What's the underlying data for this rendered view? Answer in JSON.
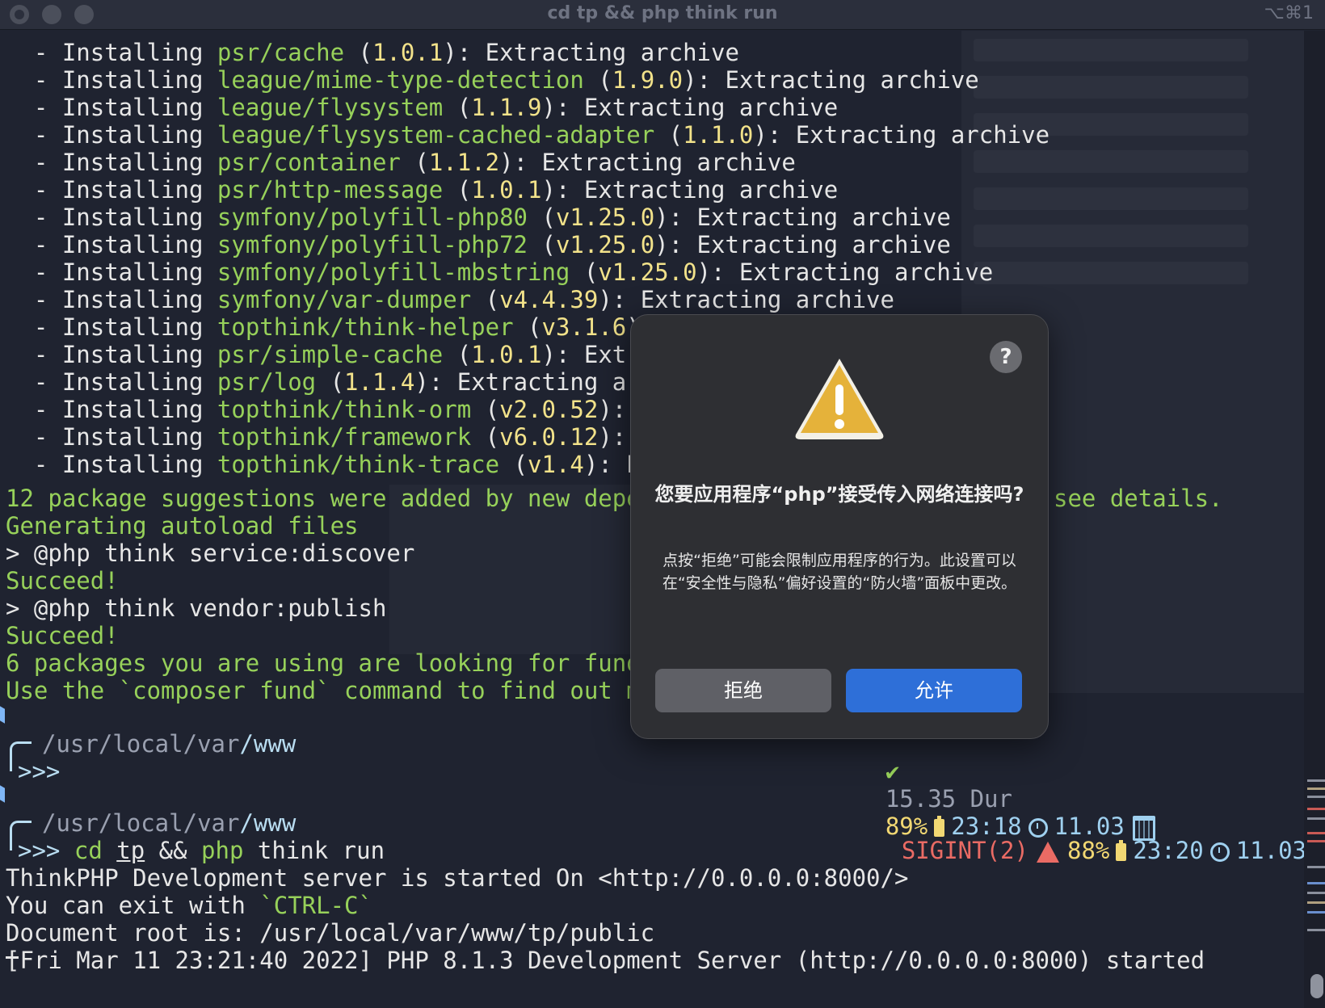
{
  "window": {
    "title": "cd tp && php think run",
    "shortcut": "⌥⌘1"
  },
  "install_lines": [
    {
      "prefix": "  - Installing ",
      "pkg": "psr/cache",
      "open": " (",
      "ver": "1.0.1",
      "rest": "): Extracting archive"
    },
    {
      "prefix": "  - Installing ",
      "pkg": "league/mime-type-detection",
      "open": " (",
      "ver": "1.9.0",
      "rest": "): Extracting archive"
    },
    {
      "prefix": "  - Installing ",
      "pkg": "league/flysystem",
      "open": " (",
      "ver": "1.1.9",
      "rest": "): Extracting archive"
    },
    {
      "prefix": "  - Installing ",
      "pkg": "league/flysystem-cached-adapter",
      "open": " (",
      "ver": "1.1.0",
      "rest": "): Extracting archive"
    },
    {
      "prefix": "  - Installing ",
      "pkg": "psr/container",
      "open": " (",
      "ver": "1.1.2",
      "rest": "): Extracting archive"
    },
    {
      "prefix": "  - Installing ",
      "pkg": "psr/http-message",
      "open": " (",
      "ver": "1.0.1",
      "rest": "): Extracting archive"
    },
    {
      "prefix": "  - Installing ",
      "pkg": "symfony/polyfill-php80",
      "open": " (",
      "ver": "v1.25.0",
      "rest": "): Extracting archive"
    },
    {
      "prefix": "  - Installing ",
      "pkg": "symfony/polyfill-php72",
      "open": " (",
      "ver": "v1.25.0",
      "rest": "): Extracting archive"
    },
    {
      "prefix": "  - Installing ",
      "pkg": "symfony/polyfill-mbstring",
      "open": " (",
      "ver": "v1.25.0",
      "rest": "): Extracting archive"
    },
    {
      "prefix": "  - Installing ",
      "pkg": "symfony/var-dumper",
      "open": " (",
      "ver": "v4.4.39",
      "rest": "): Extracting archive"
    },
    {
      "prefix": "  - Installing ",
      "pkg": "topthink/think-helper",
      "open": " (",
      "ver": "v3.1.6",
      "rest": "): E"
    },
    {
      "prefix": "  - Installing ",
      "pkg": "psr/simple-cache",
      "open": " (",
      "ver": "1.0.1",
      "rest": "): Extract"
    },
    {
      "prefix": "  - Installing ",
      "pkg": "psr/log",
      "open": " (",
      "ver": "1.1.4",
      "rest": "): Extracting archi"
    },
    {
      "prefix": "  - Installing ",
      "pkg": "topthink/think-orm",
      "open": " (",
      "ver": "v2.0.52",
      "rest": "): Ext"
    },
    {
      "prefix": "  - Installing ",
      "pkg": "topthink/framework",
      "open": " (",
      "ver": "v6.0.12",
      "rest": "): Ext"
    },
    {
      "prefix": "  - Installing ",
      "pkg": "topthink/think-trace",
      "open": " (",
      "ver": "v1.4",
      "rest": "): Extra"
    }
  ],
  "output": {
    "suggestions": "12 package suggestions were added by new depende",
    "suggestions_tail": "see details.",
    "autoload": "Generating autoload files",
    "discover": "> @php think service:discover",
    "succeed1": "Succeed!",
    "publish": "> @php think vendor:publish",
    "succeed2": "Succeed!",
    "funding": "6 packages you are using are looking for funding",
    "fund_cmd": "Use the `composer fund` command to find out more"
  },
  "prompt1": {
    "path_parts": [
      "/usr",
      "/local",
      "/var",
      "/www"
    ],
    "arrow": ">>>",
    "status_check": "✔",
    "status_dur": "15.35 Dur",
    "battery": "89%",
    "time": "23:18",
    "date": "11.03"
  },
  "prompt2": {
    "path_parts": [
      "/usr",
      "/local",
      "/var",
      "/www"
    ],
    "arrow": ">>>",
    "cmd_cd": "cd",
    "cmd_dir": "tp",
    "cmd_and": "&&",
    "cmd_php": "php",
    "cmd_rest": "think run",
    "status_sig": "SIGINT(2)",
    "battery": "88%",
    "time": "23:20",
    "date": "11.03"
  },
  "server": {
    "line1": "ThinkPHP Development server is started On <http://0.0.0.0:8000/>",
    "line2_a": "You can exit with ",
    "line2_b": "`CTRL-C`",
    "line3": "Document root is: /usr/local/var/www/tp/public",
    "line4": "[Fri Mar 11 23:21:40 2022] PHP 8.1.3 Development Server (http://0.0.0.0:8000) started"
  },
  "dialog": {
    "help": "?",
    "title": "您要应用程序“php”接受传入网络连接吗?",
    "body": "点按“拒绝”可能会限制应用程序的行为。此设置可以在“安全性与隐私”偏好设置的“防火墙”面板中更改。",
    "deny": "拒绝",
    "allow": "允许"
  },
  "colors": {
    "terminal_bg": "#1f2330",
    "package": "#97d15a",
    "version": "#f2e28a",
    "allow_button": "#2e6fd8",
    "deny_button": "#5f6066"
  }
}
